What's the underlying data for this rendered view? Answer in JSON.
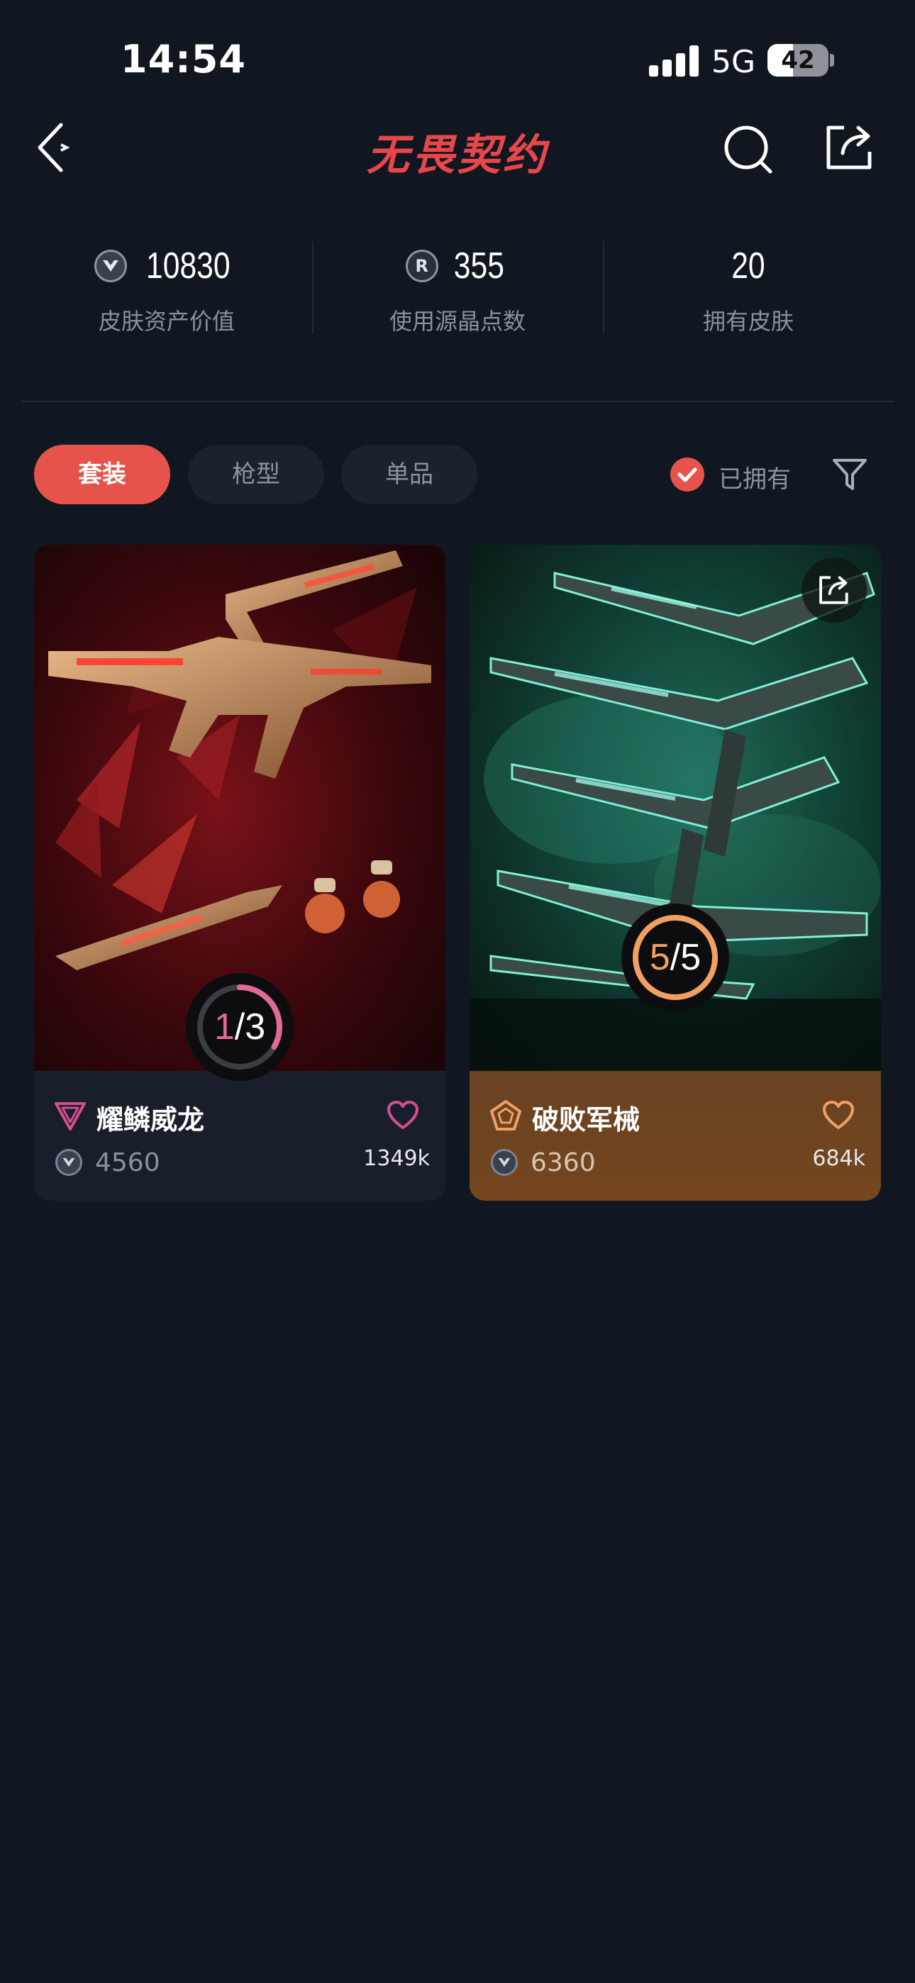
{
  "status_bar": {
    "time": "14:54",
    "network": "5G",
    "battery": "42",
    "battery_level": 0.42
  },
  "nav": {
    "title": "无畏契约",
    "back_icon": "chevron-left-icon",
    "search_icon": "search-icon",
    "share_icon": "share-icon"
  },
  "stats": [
    {
      "icon": "vp-coin-icon",
      "value": "10830",
      "label": "皮肤资产价值"
    },
    {
      "icon": "radianite-icon",
      "icon_text": "R",
      "value": "355",
      "label": "使用源晶点数"
    },
    {
      "value": "20",
      "label": "拥有皮肤"
    }
  ],
  "filters": {
    "tabs": [
      "套装",
      "枪型",
      "单品"
    ],
    "active_tab": "套装",
    "owned_label": "已拥有",
    "owned_checked": true,
    "filter_icon": "funnel-icon"
  },
  "cards": [
    {
      "name": "耀鳞威龙",
      "progress_owned": "1",
      "progress_total": "3",
      "progress_fraction": 0.3333,
      "progress_color": "#e06a9a",
      "tier_icon": "premium-tier-icon",
      "tier_color": "#d34f8d",
      "price": "4560",
      "likes": "1349k",
      "heart_color": "#d34f8d"
    },
    {
      "name": "破败军械",
      "progress_owned": "5",
      "progress_total": "5",
      "progress_fraction": 1.0,
      "progress_color": "#f0a062",
      "tier_icon": "exclusive-tier-icon",
      "tier_color": "#f0a062",
      "price": "6360",
      "likes": "684k",
      "heart_color": "#f0a062",
      "share_icon": "share-icon"
    }
  ],
  "colors": {
    "background": "#111721",
    "accent": "#e5534b"
  }
}
